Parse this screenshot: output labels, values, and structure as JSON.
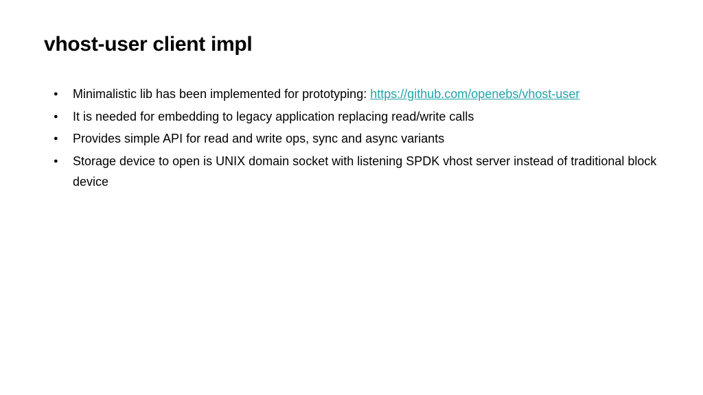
{
  "title": "vhost-user client impl",
  "bullets": [
    {
      "text_before": "Minimalistic lib has been implemented for prototyping: ",
      "link_text": "https://github.com/openebs/vhost-user",
      "link_href": "https://github.com/openebs/vhost-user"
    },
    {
      "text_before": "It is needed for embedding to legacy application replacing read/write calls"
    },
    {
      "text_before": "Provides simple API for read and write ops, sync and async variants"
    },
    {
      "text_before": "Storage device to open is UNIX domain socket with listening SPDK vhost server instead of traditional block device"
    }
  ]
}
